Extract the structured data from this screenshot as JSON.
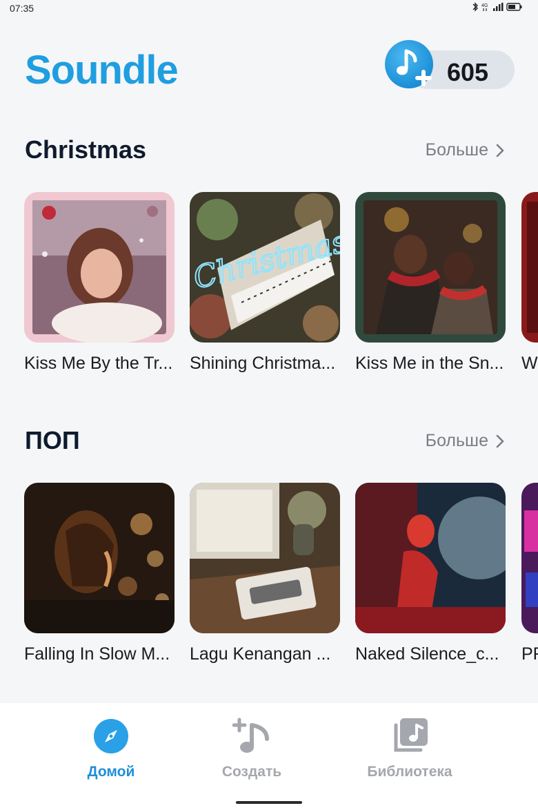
{
  "status_bar": {
    "time": "07:35",
    "icons": [
      "bluetooth-icon",
      "data-4g-icon",
      "signal-icon",
      "battery-icon"
    ]
  },
  "header": {
    "brand": "Soundle",
    "credits": {
      "icon": "music-note-plus-icon",
      "count": "605"
    }
  },
  "sections": [
    {
      "title": "Christmas",
      "more_label": "Больше",
      "cards": [
        {
          "title": "Kiss Me By the Tr...",
          "frame_color": "#f0c8d2"
        },
        {
          "title": "Shining Christma..."
        },
        {
          "title": "Kiss Me in the Sn...",
          "frame_color": "#2f4a3c"
        },
        {
          "title": "W"
        }
      ]
    },
    {
      "title": "ПОП",
      "more_label": "Больше",
      "cards": [
        {
          "title": "Falling In Slow M..."
        },
        {
          "title": "Lagu Kenangan ..."
        },
        {
          "title": "Naked Silence_c..."
        },
        {
          "title": "PF"
        }
      ]
    }
  ],
  "bottom_nav": {
    "items": [
      {
        "label": "Домой",
        "icon": "compass-icon",
        "active": true
      },
      {
        "label": "Создать",
        "icon": "create-music-icon",
        "active": false
      },
      {
        "label": "Библиотека",
        "icon": "library-icon",
        "active": false
      }
    ]
  },
  "colors": {
    "accent": "#1f9ee0",
    "background": "#f5f6f8",
    "inactive": "#a4a7ad"
  }
}
